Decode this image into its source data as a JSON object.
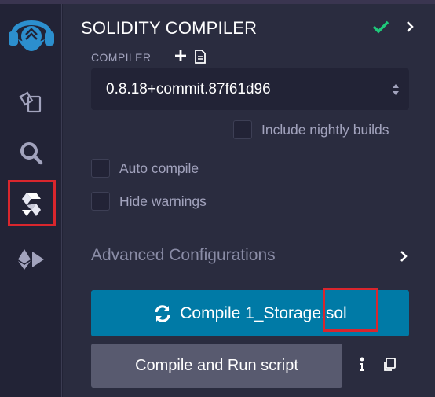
{
  "header": {
    "title": "SOLIDITY COMPILER",
    "status_icon": "check-icon",
    "expand_icon": "chevron-right-icon"
  },
  "compiler": {
    "section_label": "COMPILER",
    "add_icon": "plus-icon",
    "file_icon": "file-icon",
    "version_value": "0.8.18+commit.87f61d96"
  },
  "options": {
    "include_nightly_label": "Include nightly builds",
    "include_nightly_checked": false,
    "auto_compile_label": "Auto compile",
    "auto_compile_checked": false,
    "hide_warnings_label": "Hide warnings",
    "hide_warnings_checked": false
  },
  "advanced": {
    "label": "Advanced Configurations"
  },
  "actions": {
    "compile_label_prefix": "Compile 1_Storage",
    "compile_label_suffix": ".sol",
    "run_script_label": "Compile and Run script",
    "info_icon": "info-icon",
    "copy_icon": "copy-icon"
  },
  "iconbar": {
    "items": [
      "remix-logo",
      "file-explorer-icon",
      "search-icon",
      "solidity-compiler-icon",
      "deploy-run-icon"
    ],
    "active_item": "solidity-compiler-icon"
  },
  "colors": {
    "accent_blue": "#007aa6",
    "success_green": "#1ec97a",
    "highlight_red": "#d9262d",
    "panel_bg": "#2a2c3f",
    "sidebar_bg": "#222336"
  }
}
